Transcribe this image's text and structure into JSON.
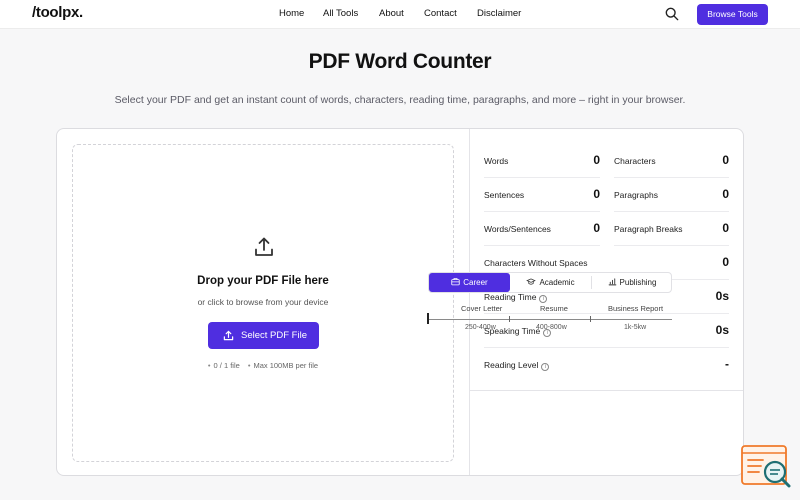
{
  "header": {
    "logo": "/toolpx.",
    "nav": [
      "Home",
      "All Tools",
      "About",
      "Contact",
      "Disclaimer"
    ],
    "browse_label": "Browse Tools"
  },
  "hero": {
    "title": "PDF Word Counter",
    "subtitle": "Select your PDF and get an instant count of words, characters, reading time, paragraphs, and more – right in your browser."
  },
  "upload": {
    "title": "Drop your PDF File here",
    "subtitle": "or click to browse from your device",
    "button_label": "Select PDF File",
    "file_count": "0 / 1 file",
    "max_size": "Max 100MB per file"
  },
  "stats": {
    "words": {
      "label": "Words",
      "value": "0"
    },
    "characters": {
      "label": "Characters",
      "value": "0"
    },
    "sentences": {
      "label": "Sentences",
      "value": "0"
    },
    "paragraphs": {
      "label": "Paragraphs",
      "value": "0"
    },
    "words_per_sentence": {
      "label": "Words/Sentences",
      "value": "0"
    },
    "paragraph_breaks": {
      "label": "Paragraph Breaks",
      "value": "0"
    },
    "chars_no_spaces": {
      "label": "Characters Without Spaces",
      "value": "0"
    },
    "reading_time": {
      "label": "Reading Time",
      "value": "0s"
    },
    "speaking_time": {
      "label": "Speaking Time",
      "value": "0s"
    },
    "reading_level": {
      "label": "Reading Level",
      "value": "-"
    }
  },
  "tabs": [
    {
      "label": "Career",
      "icon": "briefcase-icon",
      "active": true
    },
    {
      "label": "Academic",
      "icon": "graduation-cap-icon",
      "active": false
    },
    {
      "label": "Publishing",
      "icon": "chart-icon",
      "active": false
    }
  ],
  "ranges": [
    {
      "label": "Cover Letter",
      "range": "250-400w"
    },
    {
      "label": "Resume",
      "range": "400-800w"
    },
    {
      "label": "Business Report",
      "range": "1k-5kw"
    }
  ],
  "colors": {
    "accent": "#4f2ee0",
    "widget_orange": "#f07a2a",
    "widget_teal": "#1f6f73"
  }
}
